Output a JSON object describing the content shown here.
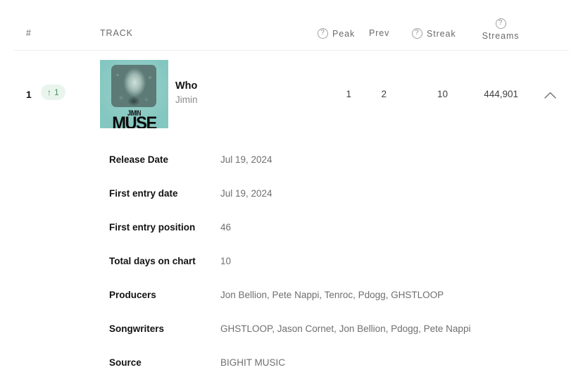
{
  "header": {
    "rank_label": "#",
    "track_label": "TRACK",
    "peak_label": "Peak",
    "prev_label": "Prev",
    "streak_label": "Streak",
    "streams_label": "Streams",
    "help_glyph": "?"
  },
  "track": {
    "rank": "1",
    "move_arrow": "↑",
    "move_value": "1",
    "title": "Who",
    "artist": "Jimin",
    "album_art": {
      "artist_text": "JIMIN",
      "album_text": "MUSE",
      "background_color": "#84c7c0"
    },
    "peak": "1",
    "prev": "2",
    "streak": "10",
    "streams": "444,901",
    "collapse_icon": "chevron-up"
  },
  "details": [
    {
      "label": "Release Date",
      "value": "Jul 19, 2024"
    },
    {
      "label": "First entry date",
      "value": "Jul 19, 2024"
    },
    {
      "label": "First entry position",
      "value": "46"
    },
    {
      "label": "Total days on chart",
      "value": "10"
    },
    {
      "label": "Producers",
      "value": "Jon Bellion, Pete Nappi, Tenroc, Pdogg, GHSTLOOP"
    },
    {
      "label": "Songwriters",
      "value": "GHSTLOOP, Jason Cornet, Jon Bellion, Pdogg, Pete Nappi"
    },
    {
      "label": "Source",
      "value": "BIGHIT MUSIC"
    }
  ],
  "colors": {
    "background": "#ffffff",
    "text_primary": "#121212",
    "text_muted": "#6f6f6f",
    "badge_background": "#e9f5ec",
    "badge_text": "#4b8d62",
    "divider": "#eceded"
  }
}
